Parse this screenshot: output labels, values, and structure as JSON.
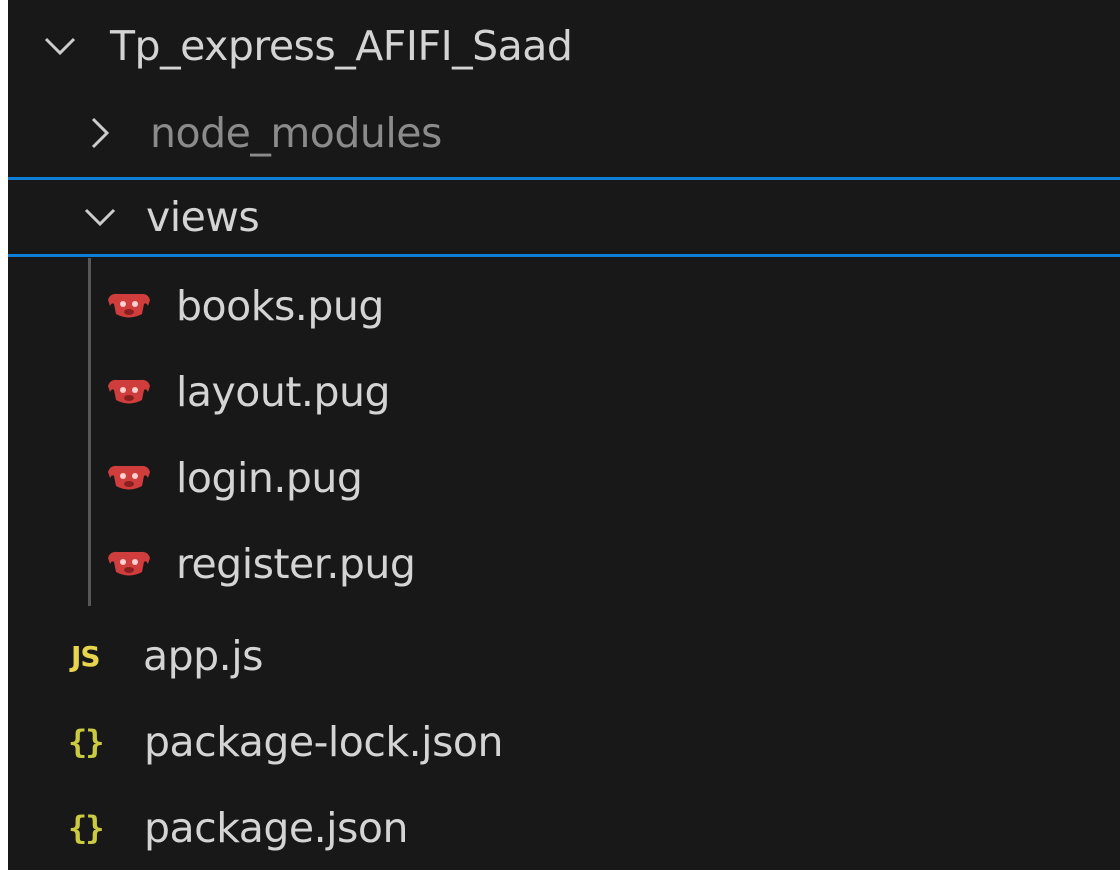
{
  "explorer": {
    "root": {
      "label": "Tp_express_AFIFI_Saad",
      "icon": "chevron-down-icon",
      "expanded": true
    },
    "node_modules": {
      "label": "node_modules",
      "icon": "chevron-right-icon",
      "expanded": false
    },
    "views": {
      "label": "views",
      "icon": "chevron-down-icon",
      "expanded": true,
      "files": [
        {
          "label": "books.pug",
          "icon": "pug-icon"
        },
        {
          "label": "layout.pug",
          "icon": "pug-icon"
        },
        {
          "label": "login.pug",
          "icon": "pug-icon"
        },
        {
          "label": "register.pug",
          "icon": "pug-icon"
        }
      ]
    },
    "files": [
      {
        "label": "app.js",
        "icon": "js-icon",
        "icon_text": "JS"
      },
      {
        "label": "package-lock.json",
        "icon": "json-icon",
        "icon_text": "{}"
      },
      {
        "label": "package.json",
        "icon": "json-icon",
        "icon_text": "{}"
      }
    ]
  },
  "colors": {
    "background": "#181818",
    "focus_border": "#0e7fd6",
    "pug": "#cf3d3d",
    "js": "#e8d44d",
    "json": "#cbcb41"
  }
}
